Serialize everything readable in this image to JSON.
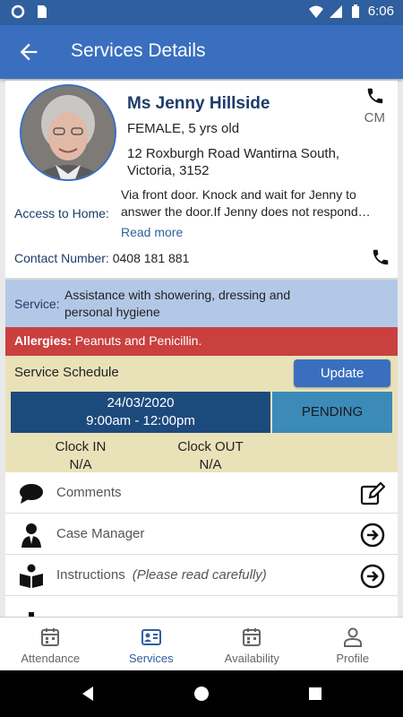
{
  "status_bar": {
    "time": "6:06"
  },
  "appbar": {
    "title": "Services Details"
  },
  "client": {
    "name": "Ms Jenny Hillside",
    "gender_age": "FEMALE, 5 yrs old",
    "address": "12 Roxburgh Road Wantirna South, Victoria, 3152",
    "cm_label": "CM",
    "access_label": "Access to Home:",
    "access_text": "Via front door.  Knock and wait for Jenny to answer the door.If Jenny does not respond…",
    "read_more": "Read more",
    "contact_label": "Contact Number:",
    "contact_number": "0408 181 881"
  },
  "service": {
    "label": "Service:",
    "value": "Assistance with showering, dressing and personal hygiene"
  },
  "allergies": {
    "label": "Allergies:",
    "value": "Peanuts and Penicillin."
  },
  "schedule": {
    "heading": "Service Schedule",
    "update_label": "Update",
    "date": "24/03/2020",
    "time": "9:00am - 12:00pm",
    "status": "PENDING",
    "clock_in_label": "Clock IN",
    "clock_in_value": "N/A",
    "clock_out_label": "Clock OUT",
    "clock_out_value": "N/A"
  },
  "rows": [
    {
      "label": "Comments",
      "icon": "comment-icon",
      "action_icon": "edit-icon"
    },
    {
      "label": "Case Manager",
      "icon": "person-icon",
      "action_icon": "arrow-right-circle-icon"
    },
    {
      "label": "Instructions",
      "hint": "(Please read carefully)",
      "icon": "book-reader-icon",
      "action_icon": "arrow-right-circle-icon"
    }
  ],
  "bottom_nav": [
    {
      "label": "Attendance",
      "icon": "calendar-icon",
      "active": false
    },
    {
      "label": "Services",
      "icon": "id-card-icon",
      "active": true
    },
    {
      "label": "Availability",
      "icon": "calendar-icon",
      "active": false
    },
    {
      "label": "Profile",
      "icon": "person-outline-icon",
      "active": false
    }
  ],
  "colors": {
    "primary": "#3a6fbf",
    "status_bar": "#2f5f9f",
    "service_bg": "#b3c8e6",
    "allergy_bg": "#c9403f",
    "schedule_bg": "#e9e2b9",
    "date_bg": "#1d4a7d",
    "status_bg": "#3b8ab8"
  }
}
